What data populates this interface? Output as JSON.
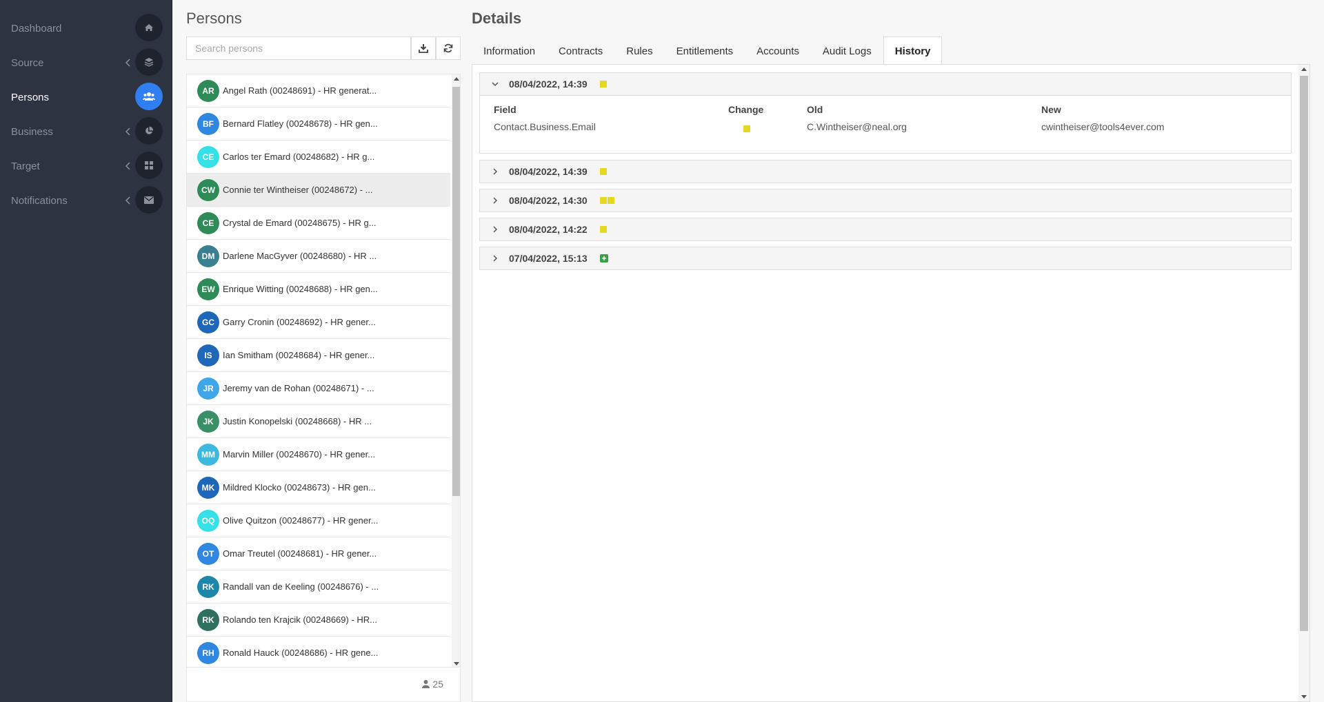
{
  "sidebar": {
    "items": [
      {
        "label": "Dashboard",
        "icon": "home-icon",
        "chevron": false,
        "active": false
      },
      {
        "label": "Source",
        "icon": "layers-icon",
        "chevron": true,
        "active": false
      },
      {
        "label": "Persons",
        "icon": "users-icon",
        "chevron": false,
        "active": true
      },
      {
        "label": "Business",
        "icon": "pie-chart-icon",
        "chevron": true,
        "active": false
      },
      {
        "label": "Target",
        "icon": "grid-icon",
        "chevron": true,
        "active": false
      },
      {
        "label": "Notifications",
        "icon": "envelope-icon",
        "chevron": true,
        "active": false
      }
    ]
  },
  "persons": {
    "title": "Persons",
    "search_placeholder": "Search persons",
    "count": "25",
    "items": [
      {
        "initials": "AR",
        "name": "Angel Rath (00248691) - HR generat...",
        "color": "#2e8b57"
      },
      {
        "initials": "BF",
        "name": "Bernard Flatley (00248678) - HR gen...",
        "color": "#2f87e0"
      },
      {
        "initials": "CE",
        "name": "Carlos ter Emard (00248682) - HR g...",
        "color": "#35e0e6"
      },
      {
        "initials": "CW",
        "name": "Connie ter Wintheiser (00248672) - ...",
        "color": "#2e8b57",
        "selected": true
      },
      {
        "initials": "CE",
        "name": "Crystal de Emard (00248675) - HR g...",
        "color": "#2e8b57"
      },
      {
        "initials": "DM",
        "name": "Darlene MacGyver (00248680) - HR ...",
        "color": "#3a7f8f"
      },
      {
        "initials": "EW",
        "name": "Enrique Witting (00248688) - HR gen...",
        "color": "#2e8b57"
      },
      {
        "initials": "GC",
        "name": "Garry Cronin (00248692) - HR gener...",
        "color": "#1e66b8"
      },
      {
        "initials": "IS",
        "name": "Ian Smitham (00248684) - HR gener...",
        "color": "#1e66b8"
      },
      {
        "initials": "JR",
        "name": "Jeremy van de Rohan (00248671) - ...",
        "color": "#3fa6ea"
      },
      {
        "initials": "JK",
        "name": "Justin Konopelski (00248668) - HR ...",
        "color": "#3a8f66"
      },
      {
        "initials": "MM",
        "name": "Marvin Miller (00248670) - HR gener...",
        "color": "#3fb8e0"
      },
      {
        "initials": "MK",
        "name": "Mildred Klocko (00248673) - HR gen...",
        "color": "#1e66b8"
      },
      {
        "initials": "OQ",
        "name": "Olive Quitzon (00248677) - HR gener...",
        "color": "#35e0e6"
      },
      {
        "initials": "OT",
        "name": "Omar Treutel (00248681) - HR gener...",
        "color": "#2f87e0"
      },
      {
        "initials": "RK",
        "name": "Randall van de Keeling (00248676) - ...",
        "color": "#1e86a8"
      },
      {
        "initials": "RK",
        "name": "Rolando ten Krajcik (00248669) - HR...",
        "color": "#2f7060"
      },
      {
        "initials": "RH",
        "name": "Ronald Hauck (00248686) - HR gene...",
        "color": "#2f87e0"
      }
    ]
  },
  "details": {
    "title": "Details",
    "tabs": [
      "Information",
      "Contracts",
      "Rules",
      "Entitlements",
      "Accounts",
      "Audit Logs",
      "History"
    ],
    "active_tab": "History",
    "history": [
      {
        "date": "08/04/2022, 14:39",
        "badges": [
          "change"
        ],
        "expanded": true,
        "columns": [
          "Field",
          "Change",
          "Old",
          "New"
        ],
        "rows": [
          {
            "field": "Contact.Business.Email",
            "old": "C.Wintheiser@neal.org",
            "new": "cwintheiser@tools4ever.com"
          }
        ]
      },
      {
        "date": "08/04/2022, 14:39",
        "badges": [
          "change"
        ],
        "expanded": false
      },
      {
        "date": "08/04/2022, 14:30",
        "badges": [
          "change",
          "change"
        ],
        "expanded": false
      },
      {
        "date": "08/04/2022, 14:22",
        "badges": [
          "change"
        ],
        "expanded": false
      },
      {
        "date": "07/04/2022, 15:13",
        "badges": [
          "add"
        ],
        "expanded": false
      }
    ]
  },
  "colors": {
    "change": "#e6d81c",
    "add": "#3aa14a",
    "accent": "#2f7ff0"
  }
}
